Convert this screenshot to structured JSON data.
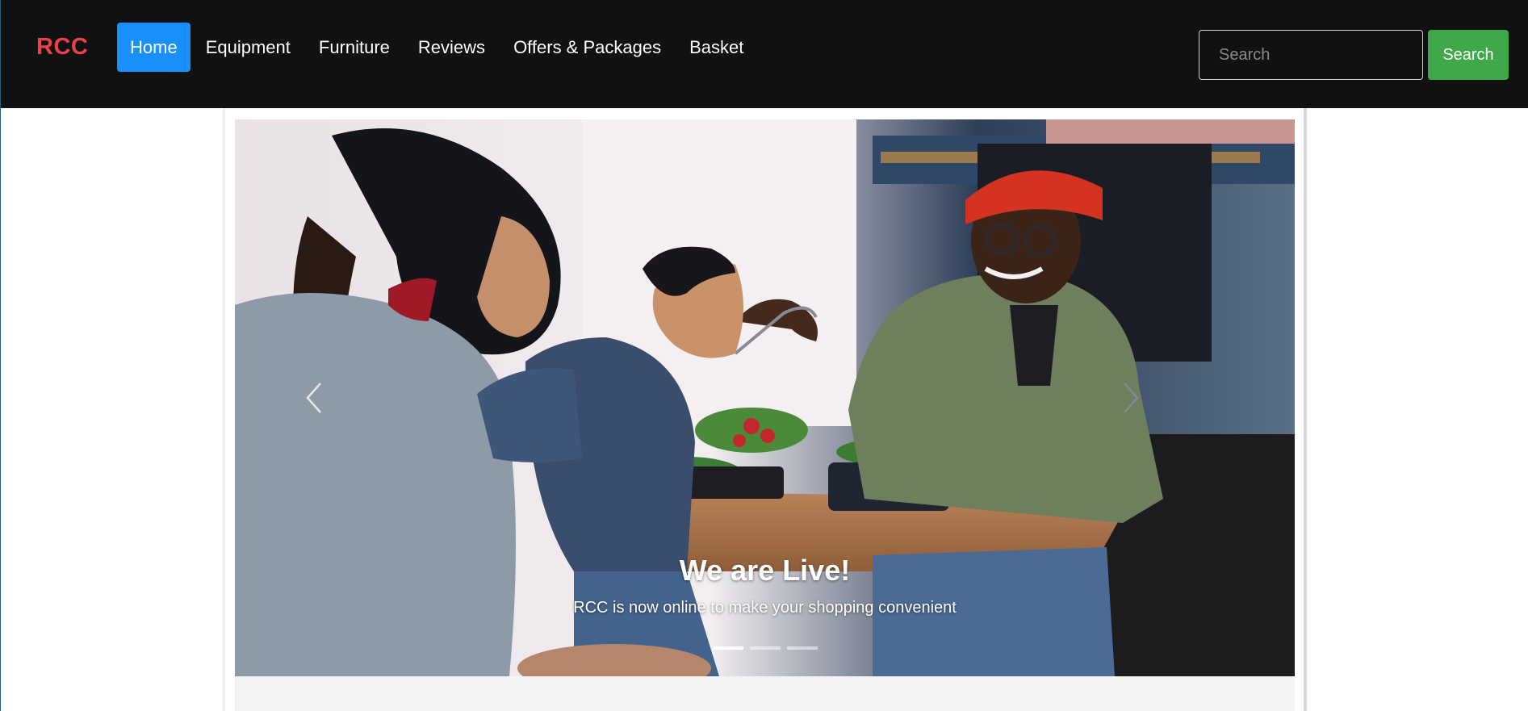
{
  "brand": "RCC",
  "nav": {
    "items": [
      {
        "label": "Home",
        "active": true
      },
      {
        "label": "Equipment",
        "active": false
      },
      {
        "label": "Furniture",
        "active": false
      },
      {
        "label": "Reviews",
        "active": false
      },
      {
        "label": "Offers & Packages",
        "active": false
      },
      {
        "label": "Basket",
        "active": false
      }
    ]
  },
  "search": {
    "placeholder": "Search",
    "value": "",
    "button_label": "Search"
  },
  "carousel": {
    "slide_count": 3,
    "active_index": 0,
    "caption_title": "We are Live!",
    "caption_text": "RCC is now online to make your shopping convenient",
    "prev_icon": "chevron-left-icon",
    "next_icon": "chevron-right-icon"
  },
  "colors": {
    "navbar_bg": "#111111",
    "brand": "#e8424b",
    "active_nav": "#1a90ff",
    "search_button": "#3fa84a"
  }
}
